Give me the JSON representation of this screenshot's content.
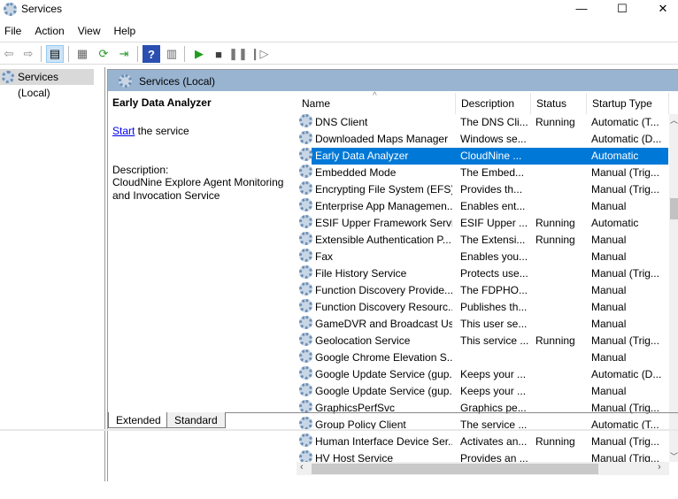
{
  "window": {
    "title": "Services",
    "minimize": "—",
    "maximize": "☐",
    "close": "✕"
  },
  "menu": [
    "File",
    "Action",
    "View",
    "Help"
  ],
  "toolbar": {
    "icons": [
      "back-arrow-icon",
      "forward-arrow-icon",
      "show-hide-console-tree-icon",
      "properties-icon",
      "refresh-icon",
      "export-list-icon",
      "help-icon",
      "action-pane-icon",
      "start-service-icon",
      "stop-service-icon",
      "pause-service-icon",
      "resume-service-icon"
    ],
    "colors": {
      "start": "#1e9e1e",
      "stop": "#404040"
    }
  },
  "tree": {
    "item": "Services (Local)"
  },
  "pane_header": "Services (Local)",
  "detail": {
    "service_name": "Early Data Analyzer",
    "start_link": "Start",
    "start_suffix": " the service",
    "description_label": "Description:",
    "description": "CloudNine Explore Agent Monitoring and Invocation Service"
  },
  "columns": [
    "Name",
    "Description",
    "Status",
    "Startup Type"
  ],
  "rows": [
    {
      "name": "DNS Client",
      "desc": "The DNS Cli...",
      "status": "Running",
      "startup": "Automatic (T..."
    },
    {
      "name": "Downloaded Maps Manager",
      "desc": "Windows se...",
      "status": "",
      "startup": "Automatic (D..."
    },
    {
      "name": "Early Data Analyzer",
      "desc": "CloudNine ...",
      "status": "",
      "startup": "Automatic",
      "selected": true
    },
    {
      "name": "Embedded Mode",
      "desc": "The Embed...",
      "status": "",
      "startup": "Manual (Trig..."
    },
    {
      "name": "Encrypting File System (EFS)",
      "desc": "Provides th...",
      "status": "",
      "startup": "Manual (Trig..."
    },
    {
      "name": "Enterprise App Managemen...",
      "desc": "Enables ent...",
      "status": "",
      "startup": "Manual"
    },
    {
      "name": "ESIF Upper Framework Servi...",
      "desc": "ESIF Upper ...",
      "status": "Running",
      "startup": "Automatic"
    },
    {
      "name": "Extensible Authentication P...",
      "desc": "The Extensi...",
      "status": "Running",
      "startup": "Manual"
    },
    {
      "name": "Fax",
      "desc": "Enables you...",
      "status": "",
      "startup": "Manual"
    },
    {
      "name": "File History Service",
      "desc": "Protects use...",
      "status": "",
      "startup": "Manual (Trig..."
    },
    {
      "name": "Function Discovery Provide...",
      "desc": "The FDPHO...",
      "status": "",
      "startup": "Manual"
    },
    {
      "name": "Function Discovery Resourc...",
      "desc": "Publishes th...",
      "status": "",
      "startup": "Manual"
    },
    {
      "name": "GameDVR and Broadcast Us...",
      "desc": "This user se...",
      "status": "",
      "startup": "Manual"
    },
    {
      "name": "Geolocation Service",
      "desc": "This service ...",
      "status": "Running",
      "startup": "Manual (Trig..."
    },
    {
      "name": "Google Chrome Elevation S...",
      "desc": "",
      "status": "",
      "startup": "Manual"
    },
    {
      "name": "Google Update Service (gup...",
      "desc": "Keeps your ...",
      "status": "",
      "startup": "Automatic (D..."
    },
    {
      "name": "Google Update Service (gup...",
      "desc": "Keeps your ...",
      "status": "",
      "startup": "Manual"
    },
    {
      "name": "GraphicsPerfSvc",
      "desc": "Graphics pe...",
      "status": "",
      "startup": "Manual (Trig..."
    },
    {
      "name": "Group Policy Client",
      "desc": "The service ...",
      "status": "",
      "startup": "Automatic (T..."
    },
    {
      "name": "Human Interface Device Ser...",
      "desc": "Activates an...",
      "status": "Running",
      "startup": "Manual (Trig..."
    },
    {
      "name": "HV Host Service",
      "desc": "Provides an ...",
      "status": "",
      "startup": "Manual (Trig..."
    }
  ],
  "tabs": [
    "Extended",
    "Standard"
  ],
  "colors": {
    "selection": "#0078d7",
    "header": "#99b4d1"
  }
}
